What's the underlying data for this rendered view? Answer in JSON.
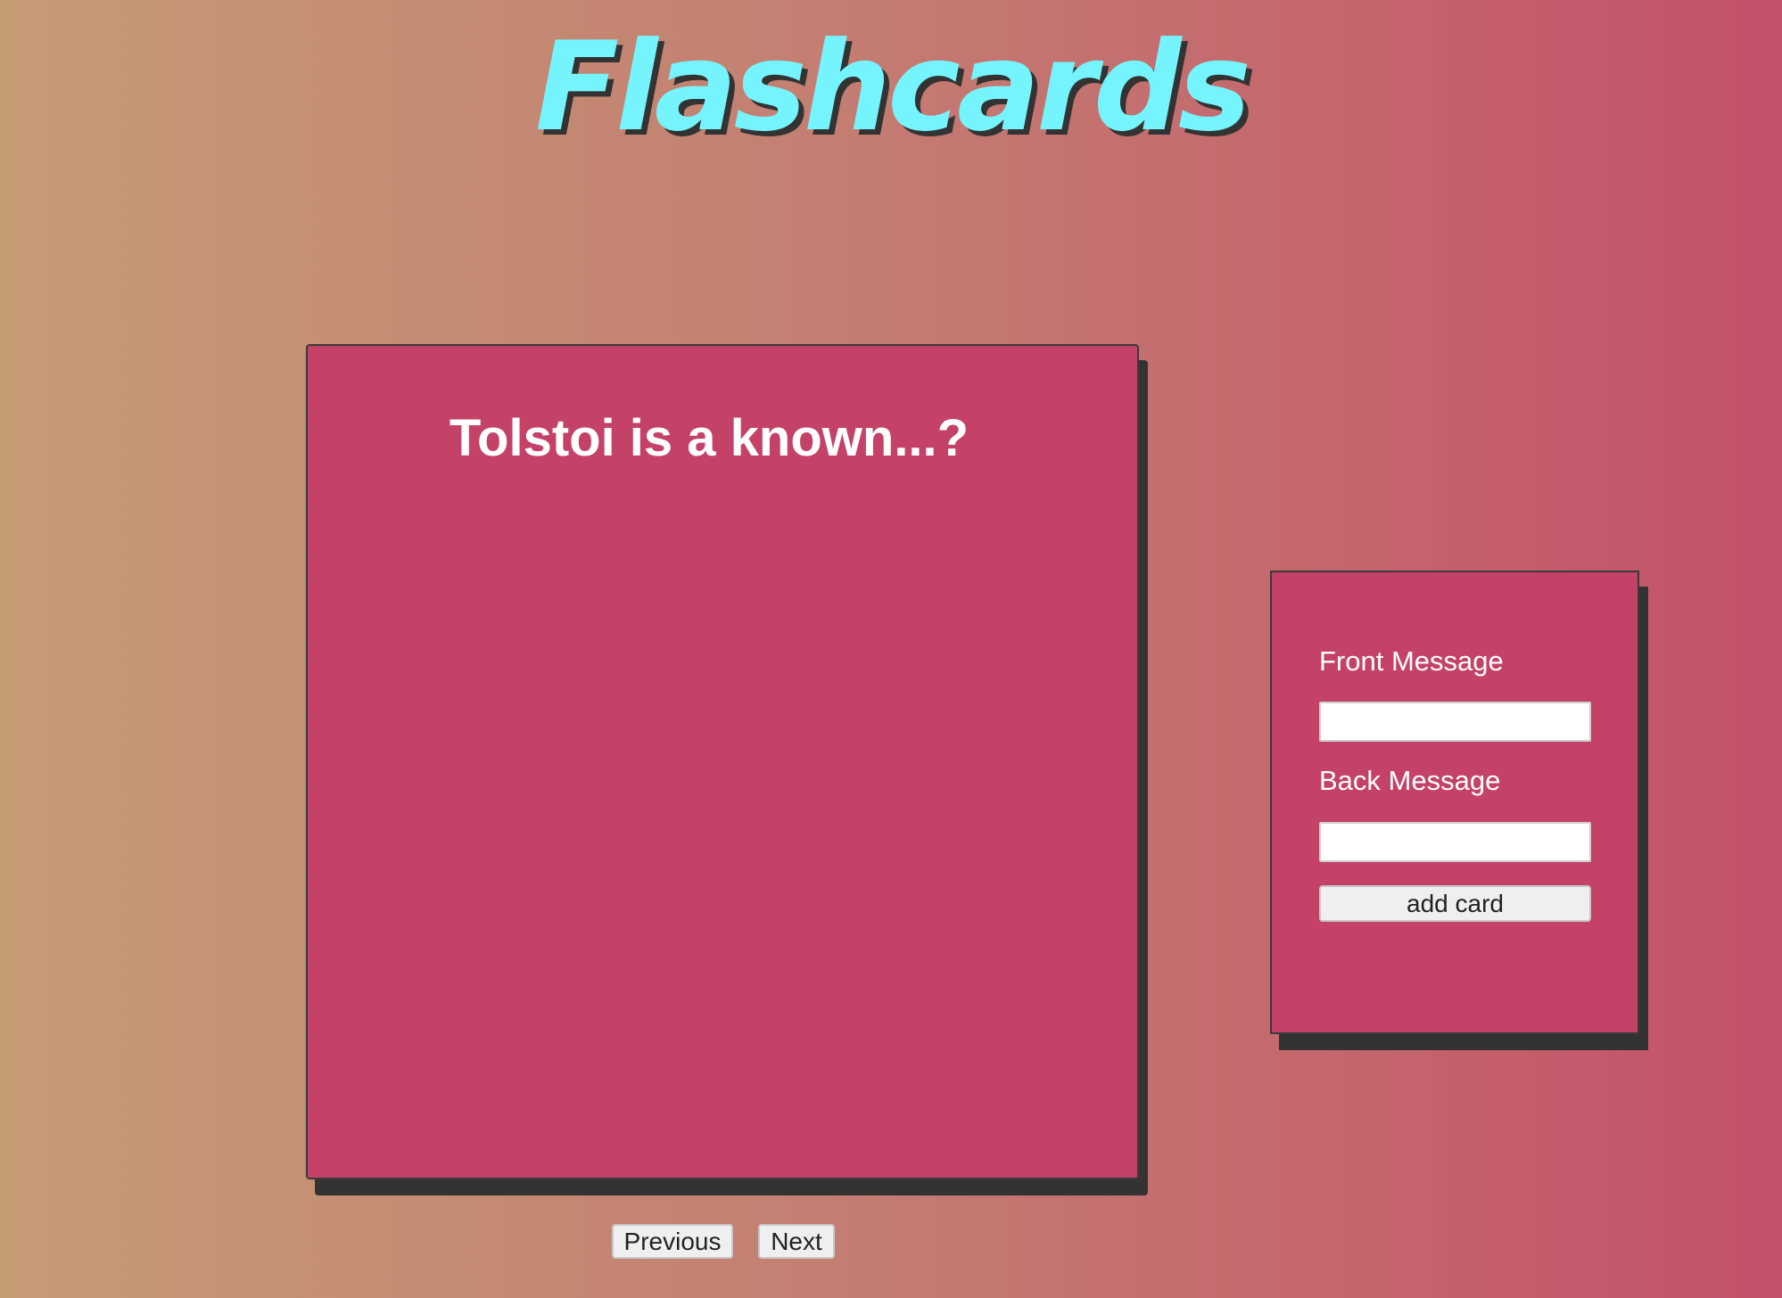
{
  "app": {
    "title": "Flashcards"
  },
  "card": {
    "front_text": "Tolstoi is a known...?"
  },
  "navigation": {
    "previous_label": "Previous",
    "next_label": "Next"
  },
  "form": {
    "front_label": "Front Message",
    "front_value": "",
    "back_label": "Back Message",
    "back_value": "",
    "add_label": "add card"
  },
  "colors": {
    "title": "#76f4fd",
    "card_background": "#c44268",
    "shadow": "#333333",
    "background_left": "#c59b74",
    "background_right": "#c4516a"
  }
}
